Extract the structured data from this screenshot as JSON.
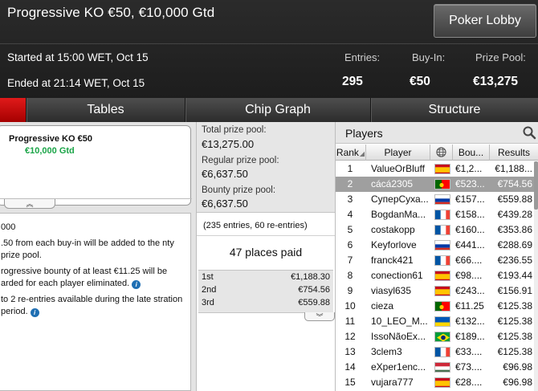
{
  "header": {
    "title": "Progressive KO €50, €10,000 Gtd",
    "lobby_button": "Poker Lobby",
    "started": "Started at 15:00 WET, Oct 15",
    "ended": "Ended at 21:14 WET, Oct 15",
    "stats": {
      "entries_label": "Entries:",
      "entries_value": "295",
      "buyin_label": "Buy-In:",
      "buyin_value": "€50",
      "prizepool_label": "Prize Pool:",
      "prizepool_value": "€13,275"
    }
  },
  "tabs": [
    "Tables",
    "Chip Graph",
    "Structure"
  ],
  "tourney_card": {
    "name": "Progressive KO €50",
    "gtd": "€10,000 Gtd",
    "collapse_glyph": "︽"
  },
  "rules": [
    "000",
    ".50 from each buy-in will be added to the nty prize pool.",
    "rogressive bounty of at least €11.25 will be arded for each player eliminated.",
    "to 2 re-entries available during the late stration period."
  ],
  "prize": {
    "total_label": "Total prize pool:",
    "total_value": "€13,275.00",
    "regular_label": "Regular prize pool:",
    "regular_value": "€6,637.50",
    "bounty_label": "Bounty prize pool:",
    "bounty_value": "€6,637.50",
    "entries_line": "(235 entries, 60 re-entries)",
    "places_paid": "47 places paid",
    "payouts": [
      {
        "place": "1st",
        "amount": "€1,188.30"
      },
      {
        "place": "2nd",
        "amount": "€754.56"
      },
      {
        "place": "3rd",
        "amount": "€559.88"
      }
    ],
    "expand_glyph": "︾"
  },
  "players": {
    "title": "Players",
    "columns": {
      "rank": "Rank",
      "player": "Player",
      "buyin": "Bou...",
      "results": "Results"
    },
    "rows": [
      {
        "rank": "1",
        "name": "ValueOrBluff",
        "flag": "es",
        "bounty": "€1,2...",
        "result": "€1,188..."
      },
      {
        "rank": "2",
        "name": "cácá2305",
        "flag": "pt",
        "bounty": "€523...",
        "result": "€754.56"
      },
      {
        "rank": "3",
        "name": "СуперСуха...",
        "flag": "ru",
        "bounty": "€157...",
        "result": "€559.88"
      },
      {
        "rank": "4",
        "name": "BogdanMa...",
        "flag": "fr",
        "bounty": "€158...",
        "result": "€439.28"
      },
      {
        "rank": "5",
        "name": "costakopp",
        "flag": "fr",
        "bounty": "€160...",
        "result": "€353.86"
      },
      {
        "rank": "6",
        "name": "Keyforlove",
        "flag": "ru",
        "bounty": "€441...",
        "result": "€288.69"
      },
      {
        "rank": "7",
        "name": "franck421",
        "flag": "fr",
        "bounty": "€66....",
        "result": "€236.55"
      },
      {
        "rank": "8",
        "name": "conection61",
        "flag": "es",
        "bounty": "€98....",
        "result": "€193.44"
      },
      {
        "rank": "9",
        "name": "viasyl635",
        "flag": "es",
        "bounty": "€243...",
        "result": "€156.91"
      },
      {
        "rank": "10",
        "name": "cieza",
        "flag": "pt",
        "bounty": "€11.25",
        "result": "€125.38"
      },
      {
        "rank": "11",
        "name": "10_LEO_M...",
        "flag": "ua",
        "bounty": "€132...",
        "result": "€125.38"
      },
      {
        "rank": "12",
        "name": "IssoNãoEx...",
        "flag": "br",
        "bounty": "€189...",
        "result": "€125.38"
      },
      {
        "rank": "13",
        "name": "3clem3",
        "flag": "fr",
        "bounty": "€33....",
        "result": "€125.38"
      },
      {
        "rank": "14",
        "name": "eXper1enc...",
        "flag": "hu",
        "bounty": "€73....",
        "result": "€96.98"
      },
      {
        "rank": "15",
        "name": "vujara777",
        "flag": "es",
        "bounty": "€28....",
        "result": "€96.98"
      }
    ]
  },
  "colors": {
    "header_bg": "#1d1d1d",
    "accent_red": "#d30000",
    "gtd_green": "#1aa447",
    "selected_row": "#9f9f9f",
    "info_blue": "#1f6fb3"
  }
}
